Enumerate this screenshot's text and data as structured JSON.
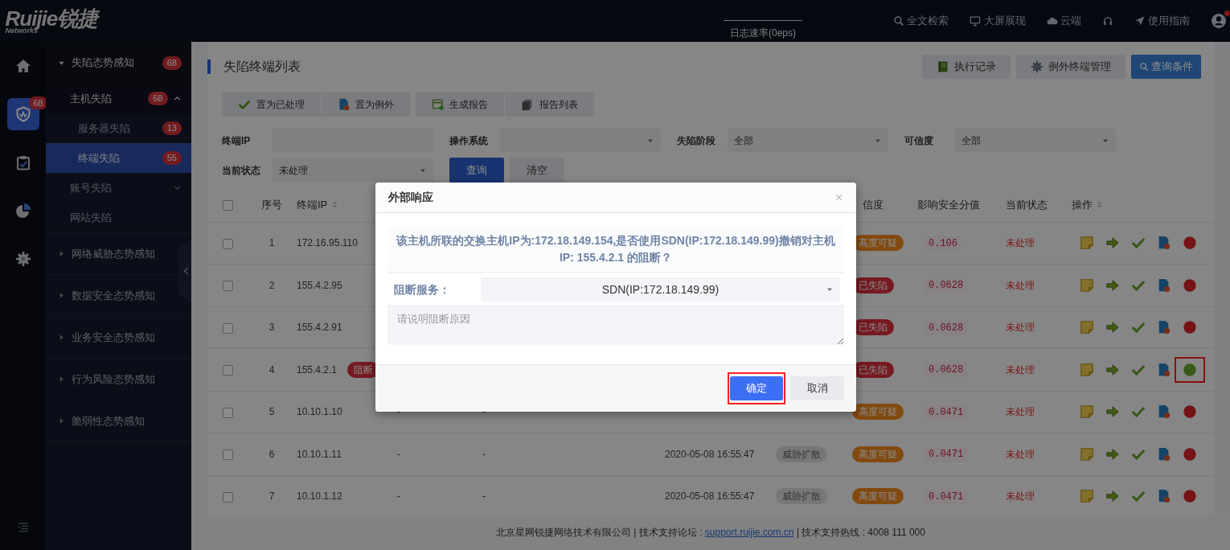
{
  "logo": {
    "brand": "Ruijie锐捷",
    "tagline": "Networks"
  },
  "top_bar": {
    "log_rate": "日志速率(0eps)",
    "links": [
      {
        "kind": "search",
        "label": "全文检索"
      },
      {
        "kind": "monitor",
        "label": "大屏展现"
      },
      {
        "kind": "cloud",
        "label": "云端"
      },
      {
        "kind": "headset"
      },
      {
        "kind": "send",
        "label": "使用指南"
      }
    ],
    "user_alert": true
  },
  "rail": [
    {
      "kind": "home",
      "selected": false
    },
    {
      "kind": "shield",
      "selected": true,
      "badge": "68"
    },
    {
      "kind": "clipboard",
      "selected": false
    },
    {
      "kind": "pie",
      "selected": false
    },
    {
      "kind": "gear",
      "selected": false
    }
  ],
  "menu": [
    {
      "label": "失陷态势感知",
      "badge": "68",
      "expanded": true,
      "children": [
        {
          "label": "主机失陷",
          "badge": "68",
          "expanded": true,
          "selected": false,
          "children": [
            {
              "label": "服务器失陷",
              "badge": "13",
              "selected": false
            },
            {
              "label": "终端失陷",
              "badge": "55",
              "selected": true
            }
          ]
        },
        {
          "label": "账号失陷",
          "expanded": false,
          "selected": false
        },
        {
          "label": "网站失陷",
          "selected": false
        }
      ]
    },
    {
      "label": "网络威胁态势感知",
      "expanded": false
    },
    {
      "label": "数据安全态势感知",
      "expanded": false
    },
    {
      "label": "业务安全态势感知",
      "expanded": false
    },
    {
      "label": "行为风险态势感知",
      "expanded": false
    },
    {
      "label": "脆弱性态势感知",
      "expanded": false
    }
  ],
  "page": {
    "title": "失陷终端列表",
    "header_buttons": [
      {
        "kind": "book",
        "label": "执行记录",
        "primary": false
      },
      {
        "kind": "gear",
        "label": "例外终端管理",
        "primary": false
      },
      {
        "kind": "search",
        "label": "查询条件",
        "primary": true
      }
    ],
    "toolbar": [
      [
        {
          "kind": "check",
          "label": "置为已处理"
        },
        {
          "kind": "doc",
          "label": "置为例外"
        }
      ],
      [
        {
          "kind": "sheet",
          "label": "生成报告"
        },
        {
          "kind": "stack",
          "label": "报告列表"
        }
      ]
    ],
    "filters": [
      {
        "label": "终端IP",
        "kind": "input"
      },
      {
        "label": "操作系统",
        "kind": "select"
      },
      {
        "label": "失陷阶段",
        "kind": "select",
        "value": "全部"
      },
      {
        "label": "可信度",
        "kind": "select",
        "value": "全部"
      },
      {
        "label": "当前状态",
        "kind": "select",
        "value": "未处理"
      }
    ],
    "filter_buttons": [
      {
        "label": "查询",
        "primary": true
      },
      {
        "label": "清空",
        "primary": false
      }
    ]
  },
  "table": {
    "all_checked": false,
    "columns": [
      {
        "label": "序号"
      },
      {
        "label": "终端IP",
        "sortable": true
      },
      {
        "label": "信度"
      },
      {
        "label": "影响安全分值"
      },
      {
        "label": "当前状态"
      },
      {
        "label": "操作",
        "sortable": true
      }
    ],
    "rows": [
      {
        "checked": false,
        "no": "1",
        "ip": "172.16.95.110",
        "credibility": {
          "label": "高度可疑",
          "kind": "suspect"
        },
        "score": "0.106",
        "status": "未处理",
        "blocked": false,
        "highlighted": false
      },
      {
        "checked": false,
        "no": "2",
        "ip": "155.4.2.95",
        "credibility": {
          "label": "已失陷",
          "kind": "fallen"
        },
        "score": "0.0628",
        "status": "未处理",
        "blocked": false,
        "highlighted": false
      },
      {
        "checked": false,
        "no": "3",
        "ip": "155.4.2.91",
        "credibility": {
          "label": "已失陷",
          "kind": "fallen"
        },
        "score": "0.0628",
        "status": "未处理",
        "blocked": false,
        "highlighted": false
      },
      {
        "checked": false,
        "no": "4",
        "ip": "155.4.2.1",
        "ip_tag": "阻断",
        "credibility": {
          "label": "已失陷",
          "kind": "fallen"
        },
        "score": "0.0628",
        "status": "未处理",
        "blocked": true,
        "highlighted": true
      },
      {
        "checked": false,
        "no": "5",
        "ip": "10.10.1.10",
        "column_4": "-",
        "column_5": "-",
        "credibility": {
          "label": "高度可疑",
          "kind": "suspect"
        },
        "score": "0.0471",
        "status": "未处理",
        "blocked": false,
        "highlighted": false
      },
      {
        "checked": false,
        "no": "6",
        "ip": "10.10.1.11",
        "column_4": "-",
        "column_5": "-",
        "time": "2020-05-08 16:55:47",
        "stage": "威胁扩散",
        "credibility": {
          "label": "高度可疑",
          "kind": "suspect"
        },
        "score": "0.0471",
        "status": "未处理",
        "blocked": false,
        "highlighted": false
      },
      {
        "checked": false,
        "no": "7",
        "ip": "10.10.1.12",
        "column_4": "-",
        "column_5": "-",
        "time": "2020-05-08 16:55:47",
        "stage": "威胁扩散",
        "credibility": {
          "label": "高度可疑",
          "kind": "suspect"
        },
        "score": "0.0471",
        "status": "未处理",
        "blocked": false,
        "highlighted": false
      }
    ]
  },
  "footer": {
    "before": "北京星网锐捷网络技术有限公司 | 技术支持论坛 : ",
    "link": "support.ruijie.com.cn",
    "after": " | 技术支持热线 : 4008 111 000"
  },
  "modal": {
    "title": "外部响应",
    "message": "该主机所联的交换主机IP为:172.18.149.154,是否使用SDN(IP:172.18.149.99)撤销对主机IP: 155.4.2.1 的阻断？",
    "field_label": "阻断服务：",
    "service": "SDN(IP:172.18.149.99)",
    "reason_placeholder": "请说明阻断原因",
    "buttons": [
      {
        "label": "确定",
        "primary": true,
        "highlighted": true
      },
      {
        "label": "取消",
        "primary": false,
        "highlighted": false
      }
    ]
  }
}
